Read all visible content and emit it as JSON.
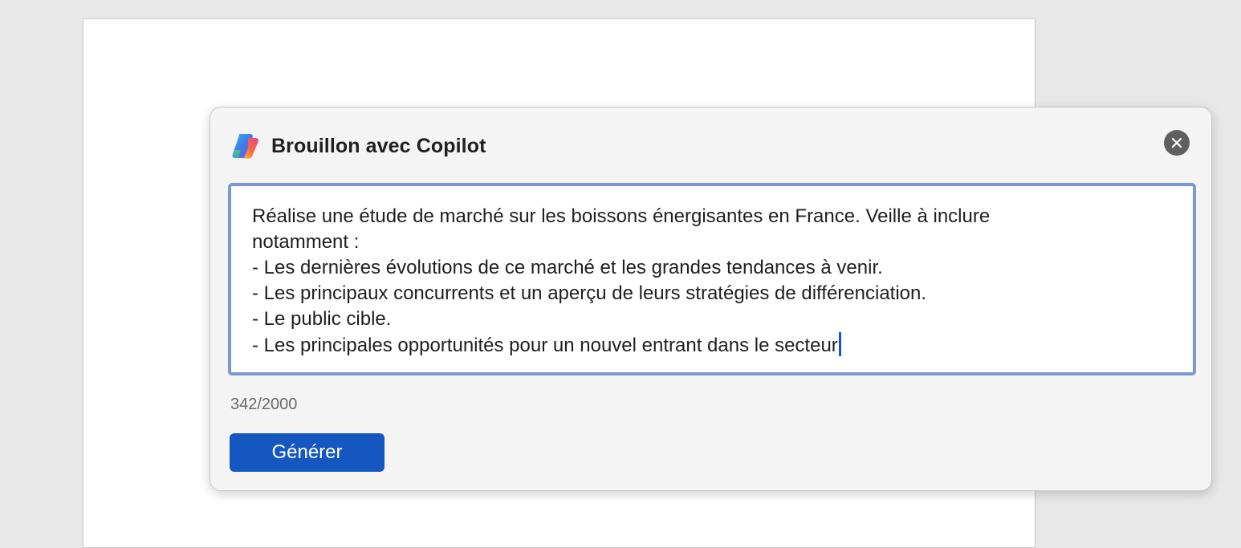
{
  "document": {
    "background": "#ffffff"
  },
  "dialog": {
    "title": "Brouillon avec Copilot",
    "logo_icon": "copilot-logo-icon",
    "close_icon": "close-icon",
    "prompt": {
      "lines": [
        "Réalise une étude de marché sur les boissons énergisantes en France. Veille à inclure",
        "notamment :",
        "- Les dernières évolutions de ce marché et les grandes tendances à venir.",
        "- Les principaux concurrents et un aperçu de leurs stratégies de différenciation.",
        "- Le public cible.",
        "- Les principales opportunités pour un nouvel entrant dans le secteur"
      ]
    },
    "char_count": "342/2000",
    "generate_label": "Générer"
  },
  "colors": {
    "accent": "#1557c0",
    "input_border": "#7c97d2",
    "caret": "#1553c9",
    "close_bg": "#5f5f5f"
  }
}
